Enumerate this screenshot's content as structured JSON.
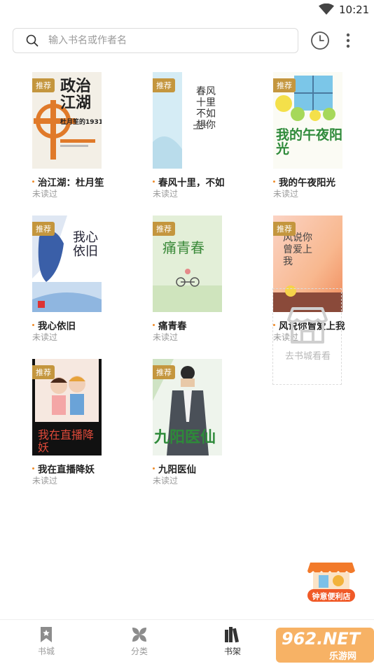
{
  "status_bar": {
    "time": "10:21",
    "wifi_icon": "wifi-icon"
  },
  "search": {
    "placeholder": "输入书名或作者名",
    "icon": "search-icon"
  },
  "toolbar": {
    "history_icon": "clock-icon",
    "more_icon": "more-vertical-icon"
  },
  "books": [
    {
      "title": "治江湖：杜月笙",
      "status": "未读过",
      "badge": "推荐",
      "cover_text": "政治江湖",
      "cover_sub": "杜月笙的1931"
    },
    {
      "title": "春风十里，不如",
      "status": "未读过",
      "badge": "推荐",
      "cover_text": "春风十里不如想你"
    },
    {
      "title": "我的午夜阳光",
      "status": "未读过",
      "badge": "推荐",
      "cover_text": "我的午夜阳光"
    },
    {
      "title": "我心依旧",
      "status": "未读过",
      "badge": "推荐",
      "cover_text": "我心依旧"
    },
    {
      "title": "痛青春",
      "status": "未读过",
      "badge": "推荐",
      "cover_text": "痛青春"
    },
    {
      "title": "风说你曾爱上我",
      "status": "未读过",
      "badge": "推荐",
      "cover_text": "风说你曾爱上我"
    },
    {
      "title": "我在直播降妖",
      "status": "未读过",
      "badge": "推荐",
      "cover_text": "我在直播降妖"
    },
    {
      "title": "九阳医仙",
      "status": "未读过",
      "badge": "推荐",
      "cover_text": "九阳医仙"
    }
  ],
  "store_card": {
    "label": "去书城看看",
    "icon": "store-icon"
  },
  "promo": {
    "label": "钟意便利店"
  },
  "tabs": [
    {
      "label": "书城",
      "icon": "bookmark-icon",
      "active": false
    },
    {
      "label": "分类",
      "icon": "category-icon",
      "active": false
    },
    {
      "label": "书架",
      "icon": "bookshelf-icon",
      "active": true
    }
  ],
  "watermark": {
    "text": "962.NET",
    "sub": "乐游网"
  },
  "colors": {
    "badge": "#c4963e",
    "dot": "#ef8d2c",
    "muted": "#9a9a9a",
    "text": "#222222"
  }
}
